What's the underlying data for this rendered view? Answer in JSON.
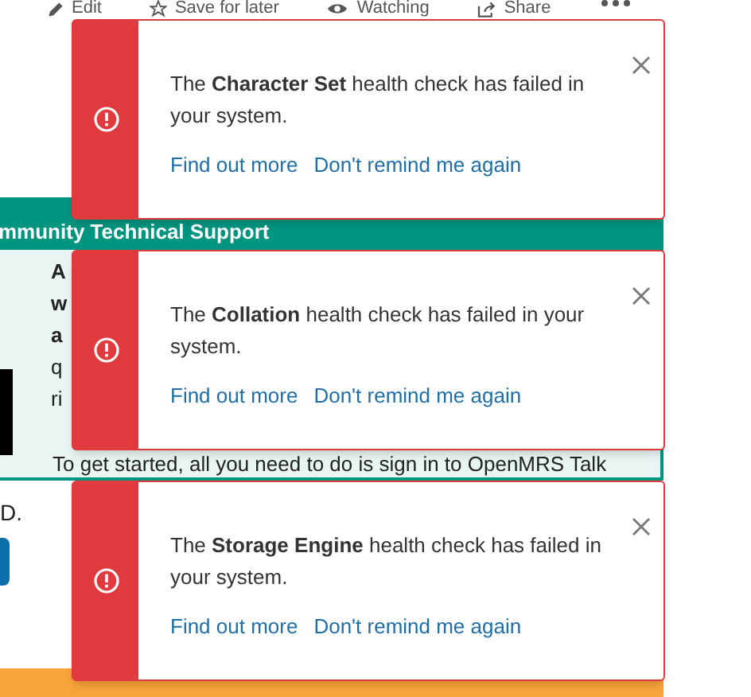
{
  "toolbar": [
    {
      "kind": "edit",
      "label": "Edit"
    },
    {
      "kind": "star",
      "label": "Save for later"
    },
    {
      "kind": "eye",
      "label": "Watching"
    },
    {
      "kind": "share",
      "label": "Share"
    }
  ],
  "panel": {
    "title": "mmunity Technical Support",
    "fragments": [
      {
        "text": "A",
        "bold": true
      },
      {
        "text": "w",
        "bold": true
      },
      {
        "text": "a",
        "bold": true
      },
      {
        "text": "q",
        "bold": false
      },
      {
        "text": "ri",
        "bold": false
      }
    ],
    "intro": "To get started, all you need to do is sign in to OpenMRS Talk",
    "fragment_2": "D."
  },
  "notifications": [
    {
      "message": "The **Character Set** health check has failed in your system.",
      "links": [
        "Find out more",
        "Don't remind me again"
      ]
    },
    {
      "message": "The **Collation** health check has failed in your system.",
      "links": [
        "Find out more",
        "Don't remind me again"
      ]
    },
    {
      "message": "The **Storage Engine** health check has failed in your system.",
      "links": [
        "Find out more",
        "Don't remind me again"
      ]
    }
  ]
}
